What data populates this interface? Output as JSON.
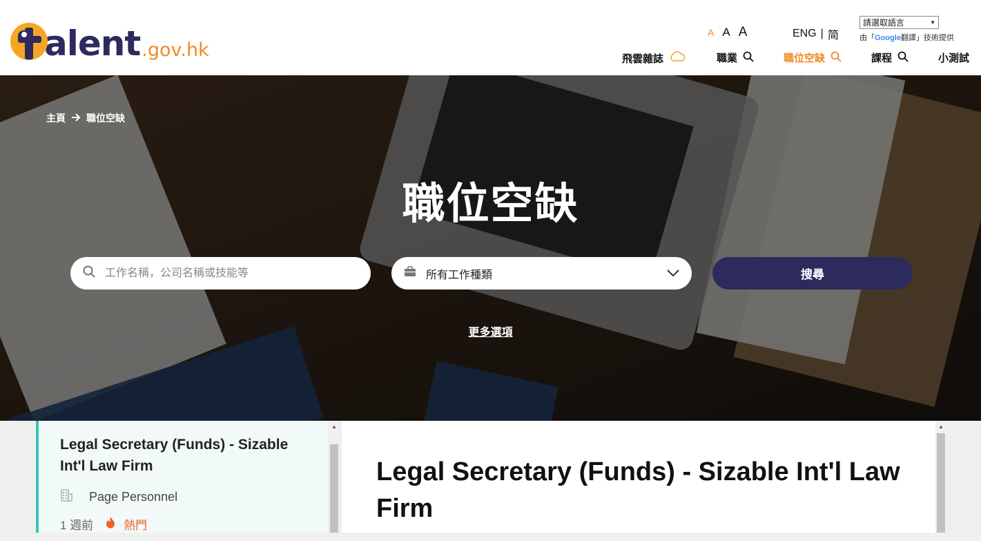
{
  "logo": {
    "word": "alent",
    "domain": ".gov.hk"
  },
  "font_size": {
    "small": "A",
    "medium": "A",
    "large": "A"
  },
  "lang": {
    "english": "ENG",
    "separator": "|",
    "simplified": "简"
  },
  "translate": {
    "select_label": "請選取語言",
    "credit_prefix": "由「",
    "credit_google": "Google",
    "credit_suffix": "翻譯」技術提供"
  },
  "nav": {
    "items": [
      {
        "label": "飛雲雜誌",
        "icon": "cloud-icon"
      },
      {
        "label": "職業",
        "icon": "search-icon"
      },
      {
        "label": "職位空缺",
        "icon": "search-icon",
        "active": true
      },
      {
        "label": "課程",
        "icon": "search-icon"
      },
      {
        "label": "小測試",
        "icon": ""
      }
    ]
  },
  "breadcrumb": {
    "home": "主頁",
    "current": "職位空缺"
  },
  "hero": {
    "title": "職位空缺",
    "search_placeholder": "工作名稱，公司名稱或技能等",
    "type_select": "所有工作種類",
    "search_button": "搜尋",
    "more_options": "更多選項"
  },
  "job_list": [
    {
      "title": "Legal Secretary (Funds) - Sizable Int'l Law Firm",
      "company": "Page Personnel",
      "posted": "1 週前",
      "tag": "熱門"
    }
  ],
  "detail": {
    "title": "Legal Secretary (Funds) - Sizable Int'l Law Firm"
  },
  "colors": {
    "brand_navy": "#2d2a5e",
    "accent_orange": "#f08a24",
    "teal": "#3bc2b8",
    "hot_red": "#f0622a"
  }
}
